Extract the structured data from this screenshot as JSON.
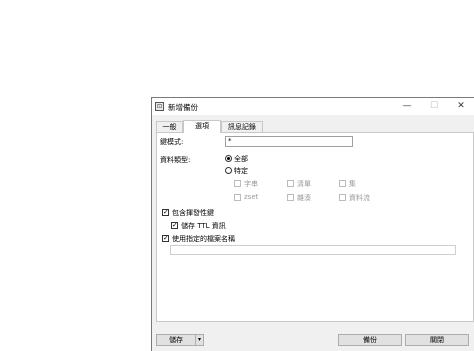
{
  "window": {
    "title": "新增備份",
    "app_icon_glyph": "⊡",
    "minimize_glyph": "—",
    "maximize_glyph": "☐",
    "close_glyph": "✕"
  },
  "tabs": [
    {
      "label": "一般",
      "active": false
    },
    {
      "label": "選項",
      "active": true
    },
    {
      "label": "訊息記錄",
      "active": false
    }
  ],
  "options": {
    "key_pattern_label": "鍵模式:",
    "key_pattern_value": "*",
    "data_type_label": "資料類型:",
    "radio_all": "全部",
    "radio_specific": "特定",
    "selected_radio": "all",
    "types": [
      {
        "label": "字串",
        "checked": false,
        "enabled": false
      },
      {
        "label": "清單",
        "checked": false,
        "enabled": false
      },
      {
        "label": "集",
        "checked": false,
        "enabled": false
      },
      {
        "label": "zset",
        "checked": false,
        "enabled": false
      },
      {
        "label": "雜湊",
        "checked": false,
        "enabled": false
      },
      {
        "label": "資料流",
        "checked": false,
        "enabled": false
      }
    ],
    "include_volatile_label": "包含揮發性鍵",
    "include_volatile_checked": true,
    "store_ttl_label": "儲存 TTL 資訊",
    "store_ttl_checked": true,
    "use_filename_label": "使用指定的檔案名稱",
    "use_filename_checked": true,
    "filename_value": ""
  },
  "footer": {
    "save_label": "儲存",
    "save_menu_glyph": "▾",
    "backup_label": "備份",
    "close_label": "關閉"
  },
  "icons": {
    "check_glyph": "✓"
  }
}
